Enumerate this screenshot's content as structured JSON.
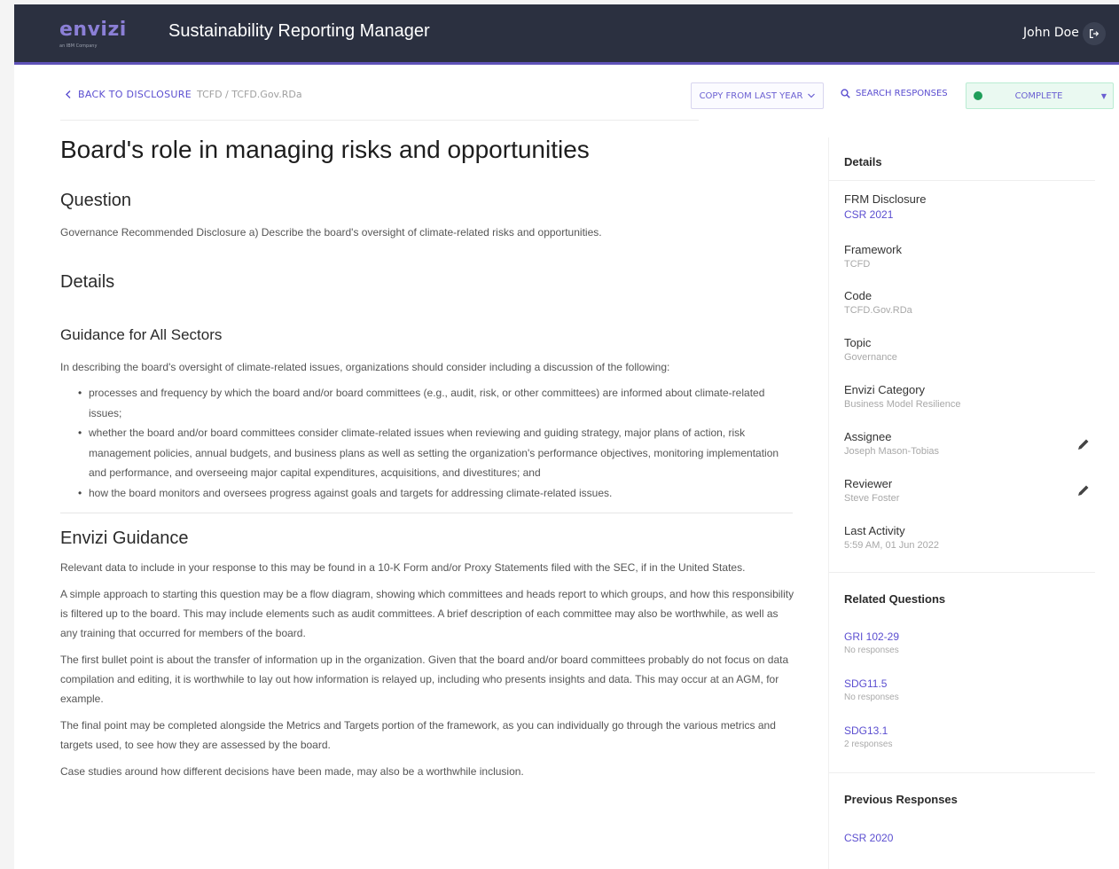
{
  "header": {
    "logo_text": "envizi",
    "logo_sub": "an IBM Company",
    "app_title": "Sustainability Reporting Manager",
    "user_name": "John Doe"
  },
  "toolbar": {
    "back_label": "BACK TO DISCLOSURE",
    "breadcrumb_path": "TCFD / TCFD.Gov.RDa",
    "copy_label": "COPY FROM LAST YEAR",
    "search_label": "SEARCH RESPONSES",
    "status_label": "COMPLETE"
  },
  "main": {
    "title": "Board's role in managing risks and opportunities",
    "question_heading": "Question",
    "question_text": "Governance Recommended Disclosure a) Describe the board's oversight of climate-related risks and opportunities.",
    "details_heading": "Details",
    "guidance_heading": "Guidance for All Sectors",
    "guidance_intro": "In describing the board's oversight of climate-related issues, organizations should consider including a discussion of the following:",
    "guidance_bullets": [
      "processes and frequency by which the board and/or board committees (e.g., audit, risk, or other committees) are informed about climate-related issues;",
      "whether the board and/or board committees consider climate-related issues when reviewing and guiding strategy, major plans of action, risk management policies, annual budgets, and business plans as well as setting the organization's performance objectives, monitoring implementation and performance, and overseeing major capital expenditures, acquisitions, and divestitures; and",
      "how the board monitors and oversees progress against goals and targets for addressing climate-related issues."
    ],
    "envizi_heading": "Envizi Guidance",
    "envizi_paragraphs": [
      "Relevant data to include in your response to this may be found in a 10-K Form and/or Proxy Statements filed with the SEC, if in the United States.",
      "A simple approach to starting this question may be a flow diagram, showing which committees and heads report to which groups, and how this responsibility is filtered up to the board. This may include elements such as audit committees. A brief description of each committee may also be worthwhile, as well as any training that occurred for members of the board.",
      "The first bullet point is about the transfer of information up in the organization. Given that the board and/or board committees probably do not focus on data compilation and editing, it is worthwhile to lay out how information is relayed up, including who presents insights and data. This may occur at an AGM, for example.",
      "The final point may be completed alongside the Metrics and Targets portion of the framework, as you can individually go through the various metrics and targets used, to see how they are assessed by the board.",
      "Case studies around how different decisions have been made, may also be a worthwhile inclusion."
    ]
  },
  "sidebar": {
    "details_title": "Details",
    "frm_label": "FRM Disclosure",
    "frm_value": "CSR 2021",
    "framework_label": "Framework",
    "framework_value": "TCFD",
    "code_label": "Code",
    "code_value": "TCFD.Gov.RDa",
    "topic_label": "Topic",
    "topic_value": "Governance",
    "category_label": "Envizi Category",
    "category_value": "Business Model Resilience",
    "assignee_label": "Assignee",
    "assignee_value": "Joseph Mason-Tobias",
    "reviewer_label": "Reviewer",
    "reviewer_value": "Steve Foster",
    "activity_label": "Last Activity",
    "activity_value": "5:59 AM, 01 Jun 2022",
    "related_title": "Related Questions",
    "related": [
      {
        "code": "GRI 102-29",
        "sub": "No responses"
      },
      {
        "code": "SDG11.5",
        "sub": "No responses"
      },
      {
        "code": "SDG13.1",
        "sub": "2 responses"
      }
    ],
    "previous_title": "Previous Responses",
    "previous_link": "CSR 2020"
  },
  "colors": {
    "header_bg": "#2b3040",
    "accent": "#5b4ed0",
    "status_green": "#1f9e5a"
  }
}
